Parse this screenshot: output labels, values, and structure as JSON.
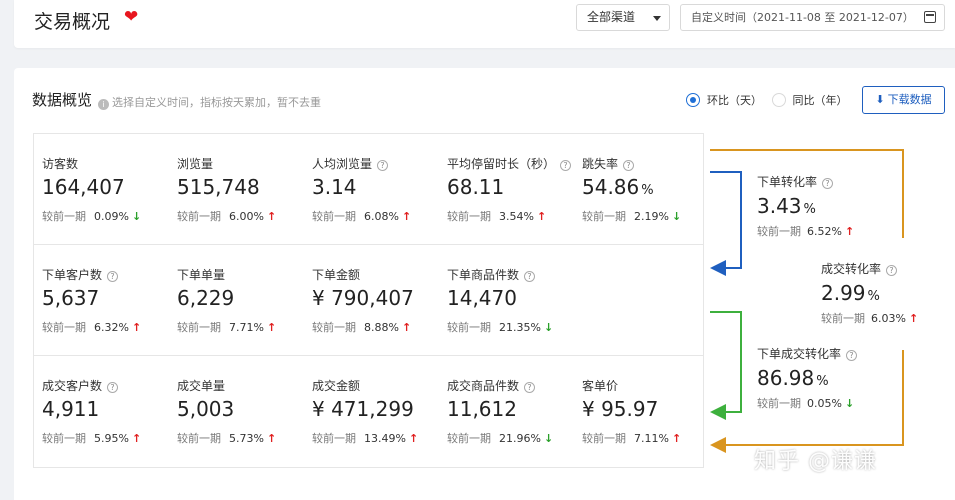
{
  "header": {
    "title": "交易概况",
    "channel_select": "全部渠道",
    "date_range": "自定义时间（2021-11-08 至 2021-12-07）"
  },
  "overview": {
    "title": "数据概览",
    "hint": "选择自定义时间，指标按天累加，暂不去重",
    "radio_day": "环比（天）",
    "radio_year": "同比（年）",
    "download_label": "下载数据",
    "compare_label": "较前一期"
  },
  "metrics": [
    {
      "label": "访客数",
      "value": "164,407",
      "unit": "",
      "pct": "0.09%",
      "trend": "down",
      "help": false
    },
    {
      "label": "浏览量",
      "value": "515,748",
      "unit": "",
      "pct": "6.00%",
      "trend": "up",
      "help": false
    },
    {
      "label": "人均浏览量",
      "value": "3.14",
      "unit": "",
      "pct": "6.08%",
      "trend": "up",
      "help": true
    },
    {
      "label": "平均停留时长（秒）",
      "value": "68.11",
      "unit": "",
      "pct": "3.54%",
      "trend": "up",
      "help": true
    },
    {
      "label": "跳失率",
      "value": "54.86",
      "unit": "%",
      "pct": "2.19%",
      "trend": "down",
      "help": true
    },
    {
      "label": "下单客户数",
      "value": "5,637",
      "unit": "",
      "pct": "6.32%",
      "trend": "up",
      "help": true
    },
    {
      "label": "下单单量",
      "value": "6,229",
      "unit": "",
      "pct": "7.71%",
      "trend": "up",
      "help": false
    },
    {
      "label": "下单金额",
      "value": "¥ 790,407",
      "unit": "",
      "pct": "8.88%",
      "trend": "up",
      "help": false
    },
    {
      "label": "下单商品件数",
      "value": "14,470",
      "unit": "",
      "pct": "21.35%",
      "trend": "down",
      "help": true
    },
    {
      "label": "成交客户数",
      "value": "4,911",
      "unit": "",
      "pct": "5.95%",
      "trend": "up",
      "help": true
    },
    {
      "label": "成交单量",
      "value": "5,003",
      "unit": "",
      "pct": "5.73%",
      "trend": "up",
      "help": false
    },
    {
      "label": "成交金额",
      "value": "¥ 471,299",
      "unit": "",
      "pct": "13.49%",
      "trend": "up",
      "help": false
    },
    {
      "label": "成交商品件数",
      "value": "11,612",
      "unit": "",
      "pct": "21.96%",
      "trend": "down",
      "help": true
    },
    {
      "label": "客单价",
      "value": "¥ 95.97",
      "unit": "",
      "pct": "7.11%",
      "trend": "up",
      "help": false
    }
  ],
  "funnel": [
    {
      "label": "下单转化率",
      "value": "3.43",
      "unit": "%",
      "pct": "6.52%",
      "trend": "up"
    },
    {
      "label": "成交转化率",
      "value": "2.99",
      "unit": "%",
      "pct": "6.03%",
      "trend": "up"
    },
    {
      "label": "下单成交转化率",
      "value": "86.98",
      "unit": "%",
      "pct": "0.05%",
      "trend": "down"
    }
  ],
  "colors": {
    "funnel_blue": "#1f5fbf",
    "funnel_green": "#3db03d",
    "funnel_orange": "#d9951f",
    "up": "#e02020",
    "down": "#2aa02a"
  },
  "watermark": "知乎 @谦谦"
}
